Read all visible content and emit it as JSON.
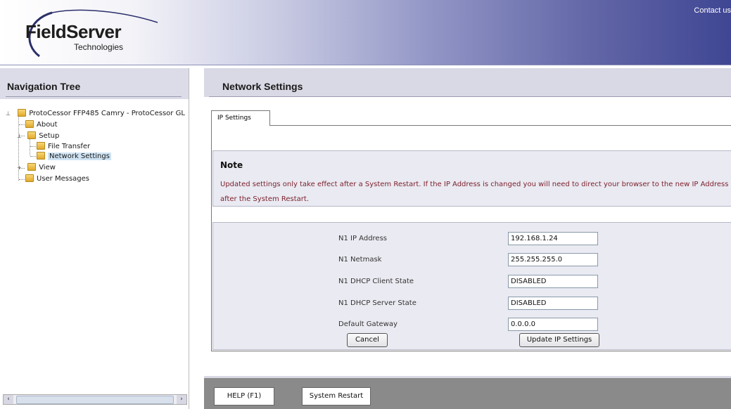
{
  "header": {
    "logo_name": "FieldServer",
    "logo_subtitle": "Technologies",
    "contact_link": "Contact us",
    "gradient_colors": [
      "#ffffff",
      "#c9cbe3",
      "#3f4693"
    ]
  },
  "nav": {
    "title": "Navigation Tree",
    "tree": [
      {
        "label": "ProtoCessor FFP485 Camry - ProtoCessor GL",
        "level": 0,
        "expander": "minus"
      },
      {
        "label": "About",
        "level": 1
      },
      {
        "label": "Setup",
        "level": 1,
        "expander": "minus"
      },
      {
        "label": "File Transfer",
        "level": 2
      },
      {
        "label": "Network Settings",
        "level": 2,
        "selected": true
      },
      {
        "label": "View",
        "level": 1,
        "expander": "plus"
      },
      {
        "label": "User Messages",
        "level": 1
      }
    ],
    "scroll_left_icon": "‹",
    "scroll_right_icon": "›"
  },
  "main": {
    "title": "Network Settings",
    "tabs": [
      {
        "label": "IP Settings",
        "active": true
      }
    ],
    "note": {
      "title": "Note",
      "text_line1": "Updated settings only take effect after a System Restart. If the IP Address is changed you will need to direct your browser to the new IP Address",
      "text_line2": "after the System Restart."
    },
    "fields": [
      {
        "label": "N1 IP Address",
        "value": "192.168.1.24"
      },
      {
        "label": "N1 Netmask",
        "value": "255.255.255.0"
      },
      {
        "label": "N1 DHCP Client State",
        "value": "DISABLED"
      },
      {
        "label": "N1 DHCP Server State",
        "value": "DISABLED"
      },
      {
        "label": "Default Gateway",
        "value": "0.0.0.0"
      }
    ],
    "buttons": {
      "cancel": "Cancel",
      "update": "Update IP Settings"
    },
    "note_text_color": "#7a1f2a"
  },
  "footer": {
    "help_button": "HELP (F1)",
    "restart_button": "System Restart"
  }
}
